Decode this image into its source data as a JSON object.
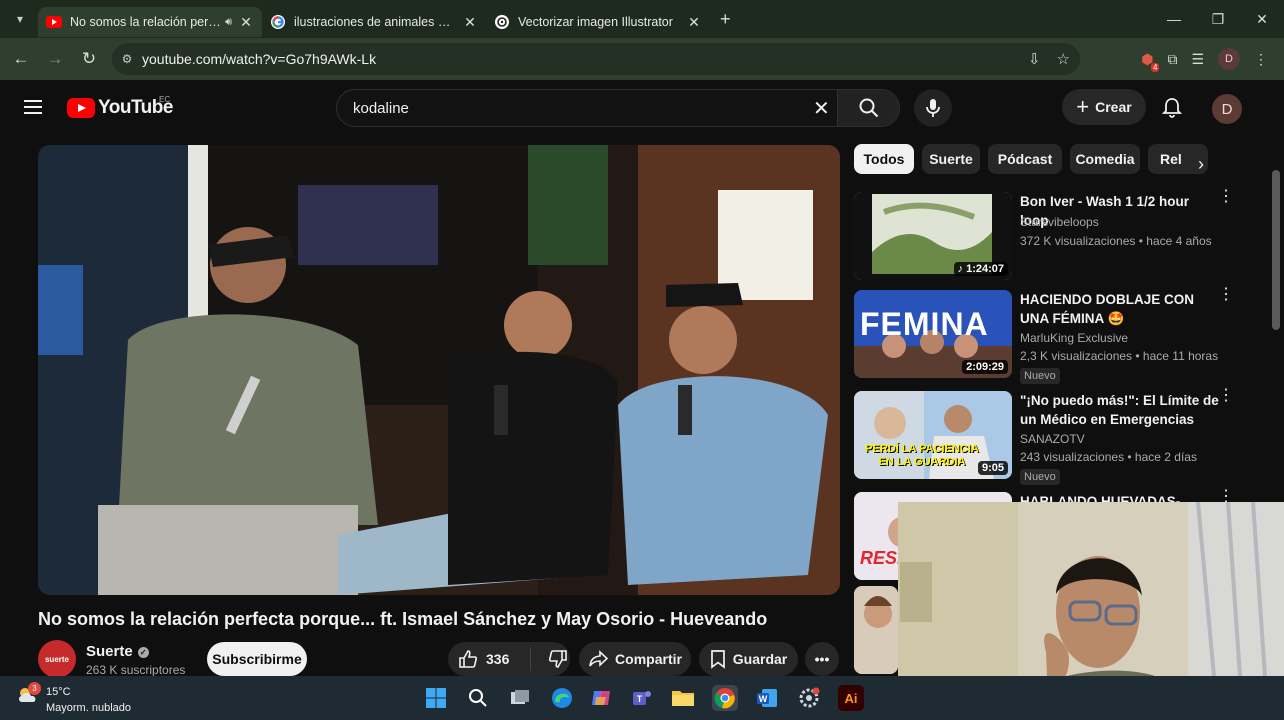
{
  "browser": {
    "tabs": [
      {
        "title": "No somos la relación perfecta porque... ft. Ismael Sánchez y May Osorio - Hueveando",
        "active": true,
        "favicon": "youtube-icon",
        "audio": true
      },
      {
        "title": "ilustraciones de animales geométricos",
        "active": false,
        "favicon": "google-icon"
      },
      {
        "title": "Vectorizar imagen Illustrator",
        "active": false,
        "favicon": "chatgpt-icon"
      }
    ],
    "url": "youtube.com/watch?v=Go7h9AWk-Lk",
    "profile_initial": "D",
    "extension_badge": "4"
  },
  "youtube": {
    "logo_text": "YouTube",
    "country_code": "EC",
    "search_value": "kodaline",
    "create_label": "Crear",
    "avatar_initial": "D",
    "video": {
      "title": "No somos la relación perfecta porque... ft. Ismael Sánchez y May Osorio - Hueveando",
      "channel": "Suerte",
      "channel_logo_text": "suerte",
      "subscribers": "263 K suscriptores",
      "subscribe_label": "Subscribirme",
      "likes": "336",
      "share_label": "Compartir",
      "save_label": "Guardar"
    },
    "chips": [
      "Todos",
      "Suerte",
      "Pódcast",
      "Comedia",
      "Rel"
    ],
    "recommendations": [
      {
        "title": "Bon Iver - Wash  1 1/2 hour loop",
        "channel": "Starsvibeloops",
        "meta": "372 K visualizaciones • hace 4 años",
        "duration": "1:24:07",
        "badge": ""
      },
      {
        "title": "HACIENDO DOBLAJE CON UNA FÉMINA 🤩",
        "channel": "MarluKing Exclusive",
        "meta": "2,3 K visualizaciones • hace 11 horas",
        "duration": "2:09:29",
        "badge": "Nuevo",
        "thumb_text": "FEMINA"
      },
      {
        "title": "\"¡No puedo más!\": El Límite de un Médico en Emergencias",
        "channel": "SANAZOTV",
        "meta": "243 visualizaciones • hace 2 días",
        "duration": "9:05",
        "badge": "Nuevo",
        "thumb_text": "PERDÍ LA PACIENCIA EN LA GUARDIA"
      },
      {
        "title": "HABLANDO HUEVADAS-",
        "thumb_text": "RESI"
      },
      {
        "title": ""
      }
    ]
  },
  "taskbar": {
    "temperature": "15°C",
    "condition": "Mayorm. nublado",
    "weather_badge": "3",
    "apps": [
      "start-icon",
      "search-icon",
      "task-view-icon",
      "edge-icon",
      "copilot-icon",
      "teams-icon",
      "file-explorer-icon",
      "chrome-icon",
      "word-icon",
      "settings-icon",
      "illustrator-icon"
    ],
    "illustrator_label": "Ai"
  },
  "colors": {
    "brand_red": "#ff0000",
    "tab_bar": "#1e2a1e",
    "toolbar": "#2f3f2f",
    "youtube_bg": "#0f0f0f",
    "taskbar": "#1f2b33"
  }
}
